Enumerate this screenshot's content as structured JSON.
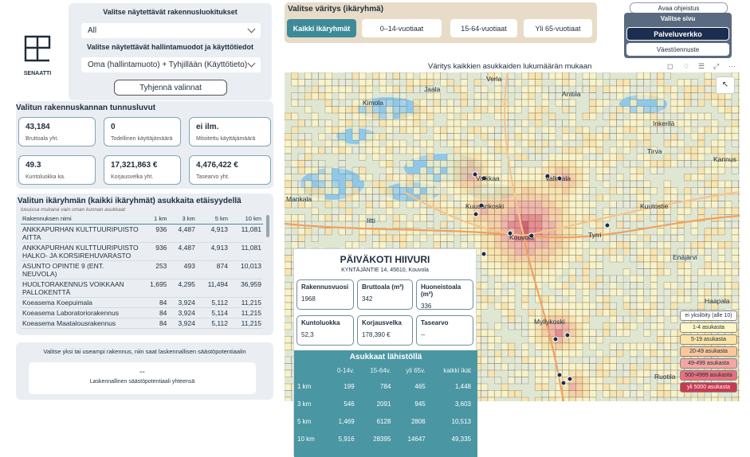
{
  "logo": {
    "text": "SENAATTI"
  },
  "filters": {
    "class_title": "Valitse näytettävät rakennusluokitukset",
    "class_value": "All",
    "tenure_title": "Valitse näytettävät hallintamuodot ja käyttötiedot",
    "tenure_value": "Oma (hallintamuoto) + Tyhjillään (Käyttötieto)",
    "clear_label": "Tyhjennä valinnat"
  },
  "kpi": {
    "title": "Valitun rakennuskannan tunnusluvut",
    "cards": [
      {
        "value": "43,184",
        "label": "Bruttoala yht."
      },
      {
        "value": "0",
        "label": "Todellinen käyttäjämäärä"
      },
      {
        "value": "ei ilm.",
        "label": "Mitoitettu käyttäjämäärä"
      },
      {
        "value": "49.3",
        "label": "Kuntoluokka ka."
      },
      {
        "value": "17,321,863 €",
        "label": "Korjausvelka yht."
      },
      {
        "value": "4,476,422 €",
        "label": "Tasearvo yht."
      }
    ]
  },
  "age_table": {
    "title": "Valitun ikäryhmän (kaikki ikäryhmät) asukkaita etäisyydellä",
    "subtitle": "luvuissa mukana vain oman kunnan asukkaat",
    "headers": [
      "Rakennuksen nimi",
      "1 km",
      "3 km",
      "5 km",
      "10 km"
    ],
    "rows": [
      {
        "name": "ANKKAPURHAN KULTTUURIPUISTO AITTA",
        "v1": "936",
        "v3": "4,487",
        "v5": "4,913",
        "v10": "11,081"
      },
      {
        "name": "ANKKAPURHAN KULTTUURIPUISTO HALKO- JA KORSIREHUVARASTO",
        "v1": "936",
        "v3": "4,487",
        "v5": "4,913",
        "v10": "11,081"
      },
      {
        "name": "ASUNTO OPINTIE 9 (ENT. NEUVOLA)",
        "v1": "253",
        "v3": "493",
        "v5": "874",
        "v10": "10,013"
      },
      {
        "name": "HUOLTORAKENNUS VOIKKAAN PALLOKENTTÄ",
        "v1": "1,695",
        "v3": "4,295",
        "v5": "11,494",
        "v10": "36,959"
      },
      {
        "name": "Koeasema Koepuimala",
        "v1": "84",
        "v3": "3,924",
        "v5": "5,112",
        "v10": "11,215"
      },
      {
        "name": "Koeasema Laboratoriorakennus",
        "v1": "84",
        "v3": "3,924",
        "v5": "5,114",
        "v10": "11,215"
      },
      {
        "name": "Koeasema Maatalousrakennus",
        "v1": "84",
        "v3": "3,924",
        "v5": "5,112",
        "v10": "11,215"
      }
    ]
  },
  "savings": {
    "instruction": "Valitse yksi tai useampi rakennus, niin saat laskennallisen säästöpotentiaalin",
    "value": "--",
    "label": "Laskennallinen säästöpotentiaali yhteensä"
  },
  "color_by": {
    "title": "Valitse väritys (ikäryhmä)",
    "options": [
      "Kaikki ikäryhmät",
      "0–14-vuotiaat",
      "15-64-vuotiaat",
      "Yli 65-vuotiaat"
    ],
    "selected": 0
  },
  "page_nav": {
    "help": "Avaa ohjeistus",
    "title": "Valitse sivu",
    "pages": [
      "Palveluverkko",
      "Väestöennuste"
    ],
    "selected": 0
  },
  "map": {
    "title": "Väritys kaikkien asukkaiden lukumäärän mukaan",
    "places": [
      "Verla",
      "Jaala",
      "Anttila",
      "Kimola",
      "Inkerilä",
      "Kannus",
      "Voikkaa",
      "Valkeala",
      "Tirva",
      "Mankala",
      "Kuusankoski",
      "Kuutostie",
      "Iitti",
      "Kouvola",
      "Tyrri",
      "Enäjärvi",
      "Myllykoski",
      "Haapala",
      "Ruotila"
    ],
    "road_numbers": [
      "12",
      "12",
      "6",
      "15",
      "6",
      "15"
    ],
    "legend": [
      {
        "label": "ei yksilöity (alle 10)",
        "color": "#ffffff"
      },
      {
        "label": "1-4 asukasta",
        "color": "#fdf6c8"
      },
      {
        "label": "5-19 asukasta",
        "color": "#fde3a7"
      },
      {
        "label": "20-49 asukasta",
        "color": "#fbc79a"
      },
      {
        "label": "49-499 asukasta",
        "color": "#f4a6a0"
      },
      {
        "label": "500-4999 asukasta",
        "color": "#e8707e"
      },
      {
        "label": "yli 5000 asukasta",
        "color": "#c83a52"
      }
    ]
  },
  "popup": {
    "title": "PÄIVÄKOTI HIIVURI",
    "address": "KYNTÄJÄNTIE 14, 45610, Kouvola",
    "cards": [
      {
        "label": "Rakennusvuosi",
        "value": "1968"
      },
      {
        "label": "Bruttoala (m²)",
        "value": "342"
      },
      {
        "label": "Huoneistoala (m²)",
        "value": "336"
      },
      {
        "label": "Kuntoluokka",
        "value": "52,3"
      },
      {
        "label": "Korjausvelka",
        "value": "178,390 €"
      },
      {
        "label": "Tasearvo",
        "value": "--"
      }
    ],
    "near_title": "Asukkaat lähistöllä",
    "near_headers": [
      "",
      "0-14v.",
      "15-64v.",
      "yli 65v.",
      "kaikki ikät"
    ],
    "near_rows": [
      [
        "1 km",
        "199",
        "784",
        "465",
        "1,448"
      ],
      [
        "3 km",
        "546",
        "2091",
        "945",
        "3,603"
      ],
      [
        "5 km",
        "1,469",
        "6128",
        "2806",
        "10,513"
      ],
      [
        "10 km",
        "5,916",
        "28395",
        "14647",
        "49,335"
      ]
    ]
  }
}
